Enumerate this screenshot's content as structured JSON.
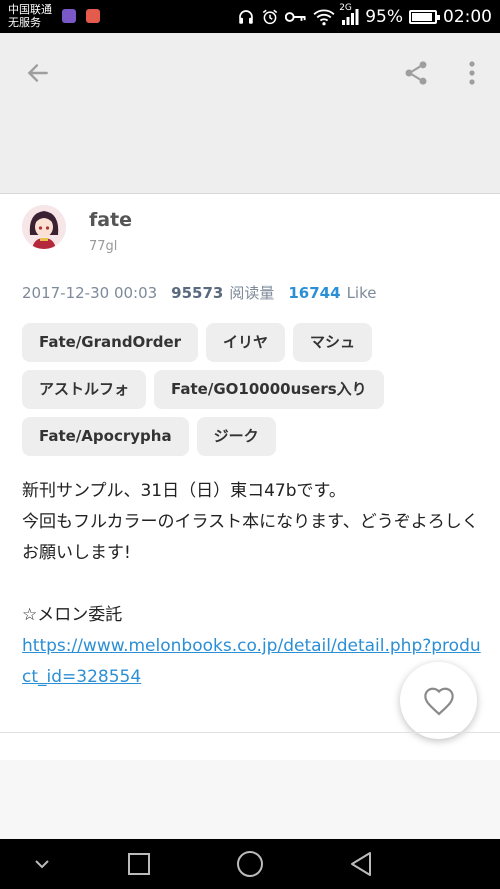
{
  "status_bar": {
    "carrier_line1": "中国联通",
    "carrier_line2": "无服务",
    "network": "2G",
    "battery": "95%",
    "time": "02:00"
  },
  "toolbar": {
    "back_icon": "back-arrow-icon",
    "share_icon": "share-icon",
    "more_icon": "more-vert-icon"
  },
  "author": {
    "name": "fate",
    "subtitle": "77gl"
  },
  "meta": {
    "date": "2017-12-30 00:03",
    "views": "95573",
    "views_label": "阅读量",
    "likes": "16744",
    "likes_label": "Like"
  },
  "tags": [
    "Fate/GrandOrder",
    "イリヤ",
    "マシュ",
    "アストルフォ",
    "Fate/GO10000users入り",
    "Fate/Apocrypha",
    "ジーク"
  ],
  "description": {
    "line1": "新刊サンプル、31日（日）東コ47bです。",
    "line2": "今回もフルカラーのイラスト本になります、どうぞよろしくお願いします!",
    "line3": "☆メロン委託",
    "link": "https://www.melonbooks.co.jp/detail/detail.php?product_id=328554"
  },
  "colors": {
    "accent": "#2b8fd6",
    "tag_bg": "#eeeeee",
    "toolbar_bg": "#eeeeee"
  }
}
